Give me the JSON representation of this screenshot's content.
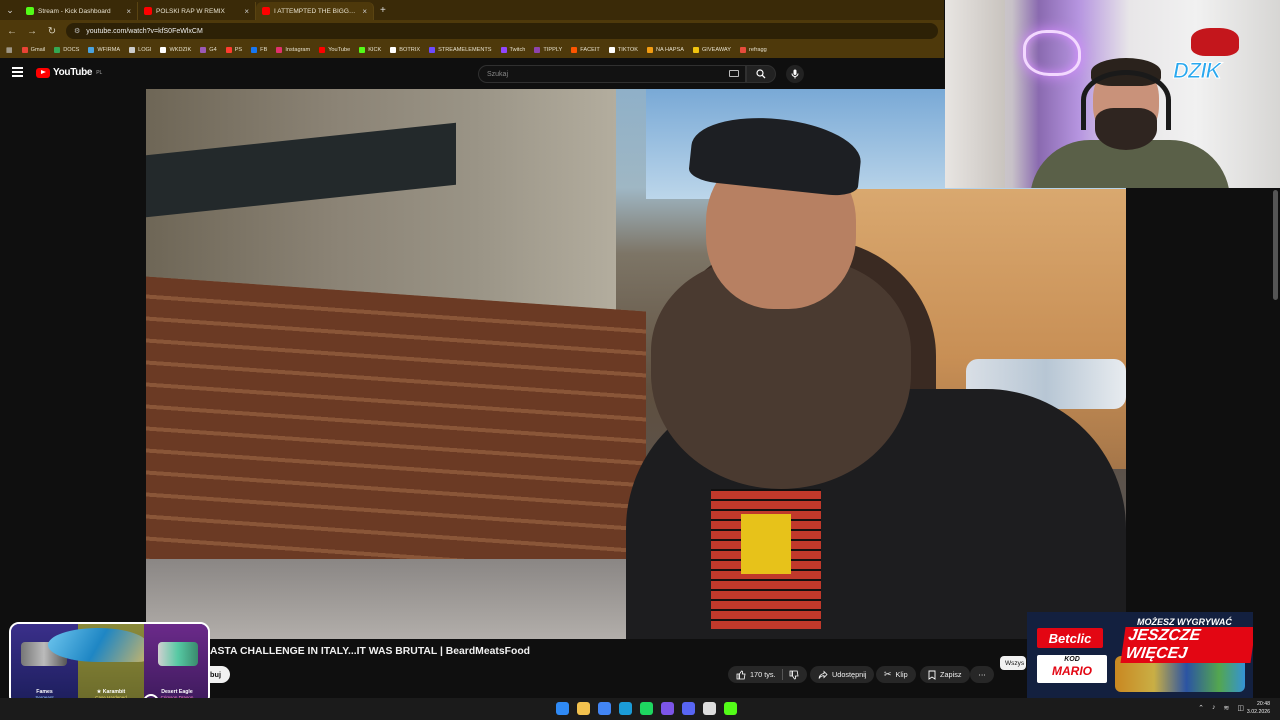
{
  "browser": {
    "tabs": [
      {
        "title": "Stream - Kick Dashboard",
        "favicon_color": "#53fc18"
      },
      {
        "title": "POLSKI RAP W REMIX",
        "favicon_color": "#ff0000"
      },
      {
        "title": "I ATTEMPTED THE BIGGEST PA",
        "favicon_color": "#ff0000"
      }
    ],
    "new_tab": "+",
    "url": "youtube.com/watch?v=kfS0FeWlxCM",
    "bookmarks": [
      {
        "label": "Gmail",
        "color": "#ea4335"
      },
      {
        "label": "DOCS",
        "color": "#34a853"
      },
      {
        "label": "WFIRMA",
        "color": "#4aa3df"
      },
      {
        "label": "LOGI",
        "color": "#cccccc"
      },
      {
        "label": "WKDZIK",
        "color": "#ffffff"
      },
      {
        "label": "G4",
        "color": "#9b59b6"
      },
      {
        "label": "PS",
        "color": "#ff3b30"
      },
      {
        "label": "FB",
        "color": "#1877f2"
      },
      {
        "label": "Instagram",
        "color": "#e1306c"
      },
      {
        "label": "YouTube",
        "color": "#ff0000"
      },
      {
        "label": "KICK",
        "color": "#53fc18"
      },
      {
        "label": "BOTRIX",
        "color": "#ffffff"
      },
      {
        "label": "STREAMELEMENTS",
        "color": "#6d4aff"
      },
      {
        "label": "Twitch",
        "color": "#9146ff"
      },
      {
        "label": "TIPPLY",
        "color": "#8e44ad"
      },
      {
        "label": "FACEIT",
        "color": "#ff5500"
      },
      {
        "label": "TIKTOK",
        "color": "#ffffff"
      },
      {
        "label": "NA HAPSA",
        "color": "#f39c12"
      },
      {
        "label": "GIVEAWAY",
        "color": "#f1c40f"
      },
      {
        "label": "refragg",
        "color": "#e74c3c"
      }
    ]
  },
  "youtube": {
    "logo_text": "YouTube",
    "region": "PL",
    "search_placeholder": "Szukaj"
  },
  "video": {
    "title": "ASTA CHALLENGE IN ITALY...IT WAS BRUTAL | BeardMeatsFood",
    "subscribe_label": "ybuj",
    "likes": "170 tys.",
    "share_label": "Udostępnij",
    "clip_label": "Klip",
    "save_label": "Zapisz",
    "more_label": "⋯",
    "chip_all": "Wszys"
  },
  "overlay": {
    "webcam_logo": "DZIK",
    "ad": {
      "brand": "Betclic",
      "line1": "MOŻESZ WYGRYWAĆ",
      "line2": "JESZCZE WIĘCEJ",
      "code_label": "KOD",
      "code": "MARIO"
    },
    "skins": [
      {
        "name": "Fames",
        "rarity": "Sergeant"
      },
      {
        "name": "★ Karambit",
        "rarity": "Case Hardened"
      },
      {
        "name": "Desert Eagle",
        "rarity": "Crimson Dragon"
      }
    ]
  },
  "taskbar": {
    "time": "20:48",
    "date": "3.02.2026",
    "app_colors": [
      "#2f8af5",
      "#f2c14e",
      "#4285f4",
      "#1b9cd8",
      "#1ed760",
      "#7c55e8",
      "#5865f2",
      "#dddddd",
      "#53fc18"
    ]
  }
}
